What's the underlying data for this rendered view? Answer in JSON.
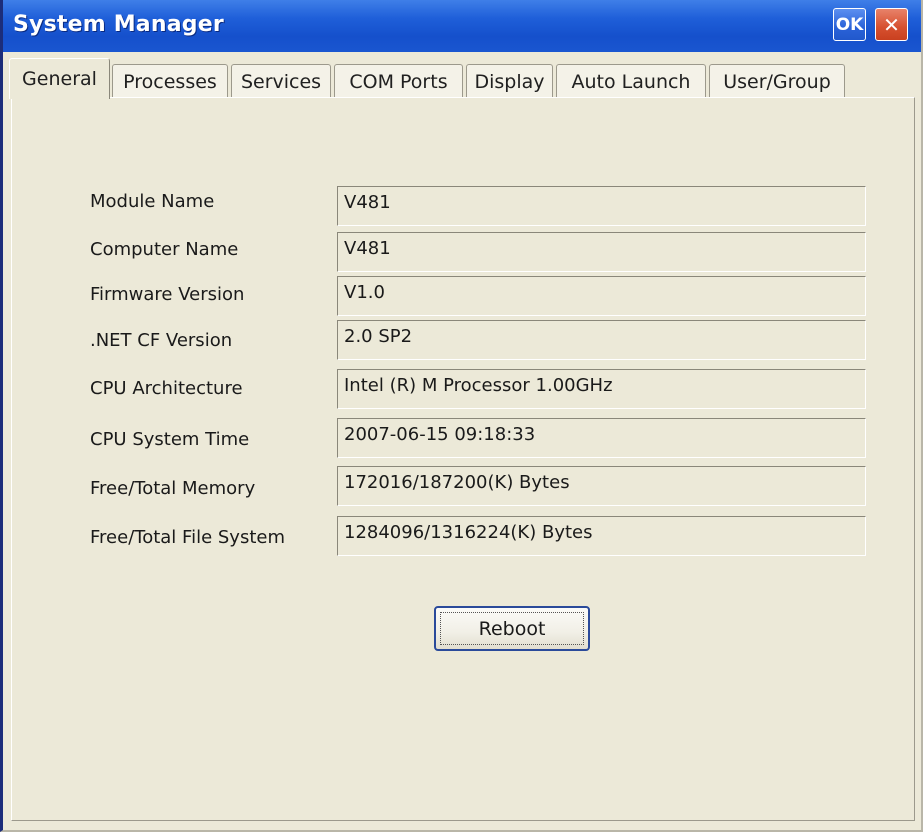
{
  "window": {
    "title": "System Manager",
    "ok_label": "OK",
    "close_glyph": "✕"
  },
  "tabs": [
    {
      "label": "General",
      "active": true
    },
    {
      "label": "Processes",
      "active": false
    },
    {
      "label": "Services",
      "active": false
    },
    {
      "label": "COM Ports",
      "active": false
    },
    {
      "label": "Display",
      "active": false
    },
    {
      "label": "Auto Launch",
      "active": false
    },
    {
      "label": "User/Group",
      "active": false
    }
  ],
  "general": {
    "rows": [
      {
        "label": "Module Name",
        "value": "V481"
      },
      {
        "label": "Computer Name",
        "value": "V481"
      },
      {
        "label": "Firmware Version",
        "value": "V1.0"
      },
      {
        "label": ".NET CF Version",
        "value": "2.0 SP2"
      },
      {
        "label": "CPU Architecture",
        "value": "Intel (R) M Processor 1.00GHz"
      },
      {
        "label": "CPU System Time",
        "value": "2007-06-15 09:18:33"
      },
      {
        "label": "Free/Total Memory",
        "value": "172016/187200(K) Bytes"
      },
      {
        "label": "Free/Total File System",
        "value": "1284096/1316224(K) Bytes"
      }
    ],
    "reboot_label": "Reboot"
  },
  "colors": {
    "titlebar": "#1f5fd9",
    "window_bg": "#ece9d8",
    "close_button": "#d6502f"
  },
  "icons": {
    "close": "close-icon"
  }
}
